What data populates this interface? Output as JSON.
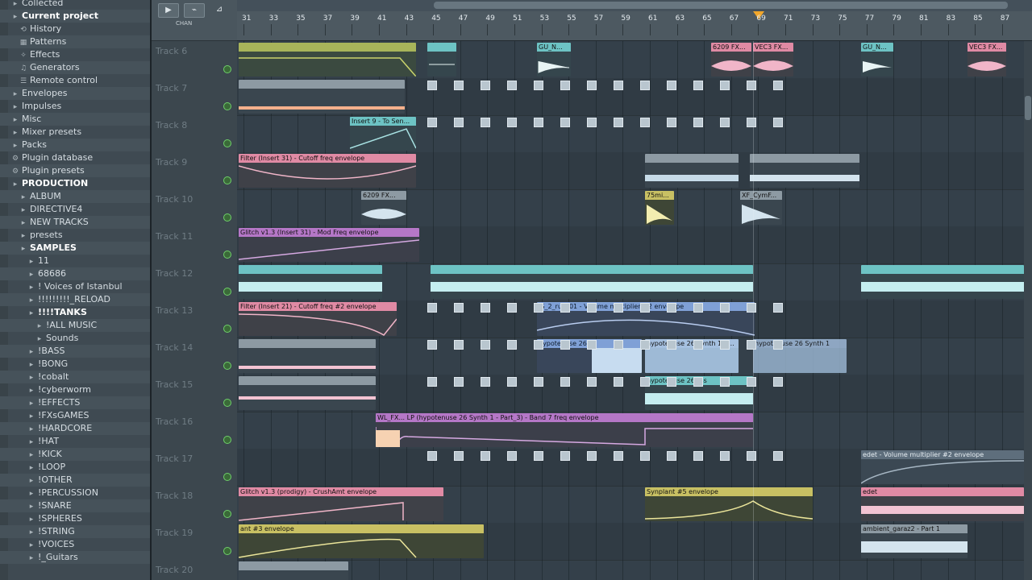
{
  "browser": {
    "items": [
      {
        "label": "Collected",
        "icon": "folder-icon",
        "indent": 0,
        "style": "plain"
      },
      {
        "label": "Current project",
        "icon": "folder-icon",
        "indent": 0,
        "style": "bold"
      },
      {
        "label": "History",
        "icon": "history-icon",
        "indent": 1,
        "style": "plain"
      },
      {
        "label": "Patterns",
        "icon": "pattern-icon",
        "indent": 1,
        "style": "plain"
      },
      {
        "label": "Effects",
        "icon": "effects-icon",
        "indent": 1,
        "style": "plain"
      },
      {
        "label": "Generators",
        "icon": "generator-icon",
        "indent": 1,
        "style": "plain"
      },
      {
        "label": "Remote control",
        "icon": "remote-icon",
        "indent": 1,
        "style": "plain"
      },
      {
        "label": "Envelopes",
        "icon": "folder-icon",
        "indent": 0,
        "style": "plain"
      },
      {
        "label": "Impulses",
        "icon": "folder-icon",
        "indent": 0,
        "style": "plain"
      },
      {
        "label": "Misc",
        "icon": "folder-icon",
        "indent": 0,
        "style": "plain"
      },
      {
        "label": "Mixer presets",
        "icon": "folder-icon",
        "indent": 0,
        "style": "plain"
      },
      {
        "label": "Packs",
        "icon": "folder-icon",
        "indent": 0,
        "style": "plain"
      },
      {
        "label": "Plugin database",
        "icon": "plugin-icon",
        "indent": 0,
        "style": "plain"
      },
      {
        "label": "Plugin presets",
        "icon": "plugin-icon",
        "indent": 0,
        "style": "plain"
      },
      {
        "label": "PRODUCTION",
        "icon": "folder-icon",
        "indent": 0,
        "style": "bold"
      },
      {
        "label": "ALBUM",
        "icon": "folder-icon",
        "indent": 1,
        "style": "plain"
      },
      {
        "label": "DIRECTIVE4",
        "icon": "folder-icon",
        "indent": 1,
        "style": "plain"
      },
      {
        "label": "NEW TRACKS",
        "icon": "folder-icon",
        "indent": 1,
        "style": "plain"
      },
      {
        "label": "presets",
        "icon": "folder-icon",
        "indent": 1,
        "style": "plain"
      },
      {
        "label": "SAMPLES",
        "icon": "folder-icon",
        "indent": 1,
        "style": "bold"
      },
      {
        "label": "11",
        "icon": "folder-icon",
        "indent": 2,
        "style": "plain"
      },
      {
        "label": "68686",
        "icon": "folder-icon",
        "indent": 2,
        "style": "plain"
      },
      {
        "label": "! Voices of Istanbul",
        "icon": "folder-icon",
        "indent": 2,
        "style": "plain"
      },
      {
        "label": "!!!!!!!!!_RELOAD",
        "icon": "folder-icon",
        "indent": 2,
        "style": "plain"
      },
      {
        "label": "!!!!TANKS",
        "icon": "folder-icon",
        "indent": 2,
        "style": "bold"
      },
      {
        "label": "!ALL MUSIC",
        "icon": "folder-icon",
        "indent": 3,
        "style": "plain"
      },
      {
        "label": "Sounds",
        "icon": "folder-icon",
        "indent": 3,
        "style": "plain"
      },
      {
        "label": "!BASS",
        "icon": "folder-icon",
        "indent": 2,
        "style": "plain"
      },
      {
        "label": "!BONG",
        "icon": "folder-icon",
        "indent": 2,
        "style": "plain"
      },
      {
        "label": "!cobalt",
        "icon": "folder-icon",
        "indent": 2,
        "style": "plain"
      },
      {
        "label": "!cyberworm",
        "icon": "folder-icon",
        "indent": 2,
        "style": "plain"
      },
      {
        "label": "!EFFECTS",
        "icon": "folder-icon",
        "indent": 2,
        "style": "plain"
      },
      {
        "label": "!FXsGAMES",
        "icon": "folder-icon",
        "indent": 2,
        "style": "plain"
      },
      {
        "label": "!HARDCORE",
        "icon": "folder-icon",
        "indent": 2,
        "style": "plain"
      },
      {
        "label": "!HAT",
        "icon": "folder-icon",
        "indent": 2,
        "style": "plain"
      },
      {
        "label": "!KICK",
        "icon": "folder-icon",
        "indent": 2,
        "style": "plain"
      },
      {
        "label": "!LOOP",
        "icon": "folder-icon",
        "indent": 2,
        "style": "plain"
      },
      {
        "label": "!OTHER",
        "icon": "folder-icon",
        "indent": 2,
        "style": "plain"
      },
      {
        "label": "!PERCUSSION",
        "icon": "folder-icon",
        "indent": 2,
        "style": "plain"
      },
      {
        "label": "!SNARE",
        "icon": "folder-icon",
        "indent": 2,
        "style": "plain"
      },
      {
        "label": "!SPHERES",
        "icon": "folder-icon",
        "indent": 2,
        "style": "plain"
      },
      {
        "label": "!STRING",
        "icon": "folder-icon",
        "indent": 2,
        "style": "plain"
      },
      {
        "label": "!VOICES",
        "icon": "folder-icon",
        "indent": 2,
        "style": "plain"
      },
      {
        "label": "!_Guitars",
        "icon": "folder-icon",
        "indent": 2,
        "style": "plain"
      }
    ]
  },
  "toolbar": {
    "snap_label": "CHAN"
  },
  "ruler": {
    "numbers": [
      "31",
      "33",
      "35",
      "37",
      "39",
      "41",
      "43",
      "45",
      "47",
      "49",
      "51",
      "53",
      "55",
      "57",
      "59",
      "61",
      "63",
      "65",
      "67",
      "69",
      "71",
      "73",
      "75",
      "77",
      "79",
      "81",
      "83",
      "85",
      "87"
    ],
    "playhead_color": "#f1a62b"
  },
  "tracks": [
    {
      "name": "Track 6"
    },
    {
      "name": "Track 7"
    },
    {
      "name": "Track 8"
    },
    {
      "name": "Track 9"
    },
    {
      "name": "Track 10"
    },
    {
      "name": "Track 11"
    },
    {
      "name": "Track 12"
    },
    {
      "name": "Track 13"
    },
    {
      "name": "Track 14"
    },
    {
      "name": "Track 15"
    },
    {
      "name": "Track 16"
    },
    {
      "name": "Track 17"
    },
    {
      "name": "Track 18"
    },
    {
      "name": "Track 19"
    },
    {
      "name": "Track 20"
    }
  ],
  "clips": {
    "t0a": "",
    "t0b": "GU_N...",
    "t0c": "6209 FX...",
    "t0d": "VEC3 FX...",
    "t0e": "GU_N...",
    "t0f": "VEC3 FX...",
    "t2a": "Insert 9 - To Sen...",
    "t3a": "Filter (Insert 31) - Cutoff freq envelope",
    "t4a": "6209 FX...",
    "t4b": "75mi...",
    "t4c": "XF_CymF...",
    "t5a": "Glitch v1.3 (Insert 31) - Mod Freq envelope",
    "t7a": "Filter (Insert 21) - Cutoff freq #2 envelope",
    "t7b": "IS_2_run_01 - Volume multiplier #2 envelope",
    "t8a": "hypotenuse 26 ...",
    "t8b": "hypotenuse 26 Synth 1 - ...",
    "t8c": "hypotenuse 26 Synth 1",
    "t9a": "hypotenuse 26 sss",
    "t10a": "WL_FX... LP (hypotenuse 26 Synth 1 - Part_3) - Band 7 freq envelope",
    "t11a": "edet - Volume multiplier #2 envelope",
    "t12a": "Glitch v1.3 (prodigy) - CrushAmt envelope",
    "t12b": "Synplant #5 envelope",
    "t12c": "edet",
    "t13a": "ant #3 envelope",
    "t13b": "ambient_garaz2 - Part 1"
  },
  "colors": {
    "olive": "#a8b45a",
    "pink": "#e08aa4",
    "purple": "#b577c7",
    "teal": "#6dc3c4",
    "blue": "#7fa0d6",
    "lightblue": "#a5c0e0",
    "yellow": "#c8c063"
  }
}
